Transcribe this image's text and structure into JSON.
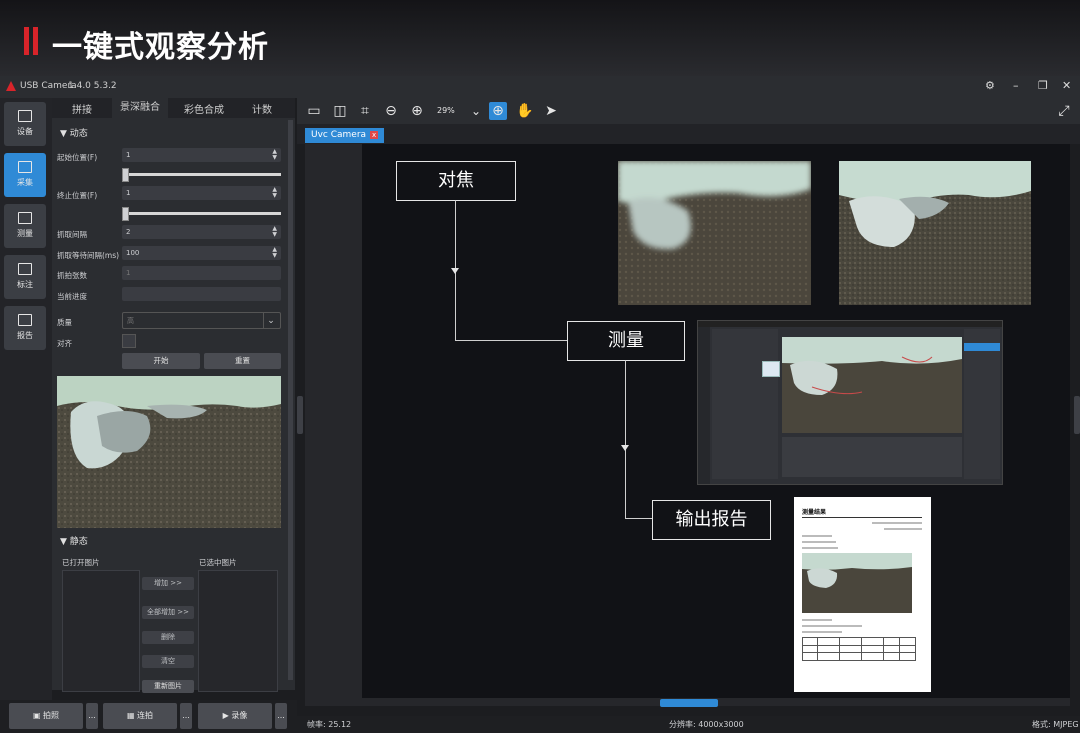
{
  "banner": {
    "title": "一键式观察分析"
  },
  "window": {
    "app_name": "USB Camera",
    "version": "1.4.0 5.3.2"
  },
  "nav": {
    "items": [
      {
        "label": "设备"
      },
      {
        "label": "采集"
      },
      {
        "label": "测量"
      },
      {
        "label": "标注"
      },
      {
        "label": "报告"
      }
    ],
    "active_index": 1
  },
  "panel": {
    "tabs": [
      "拼接",
      "景深融合",
      "彩色合成",
      "计数"
    ],
    "active_tab": 1,
    "dynamic_section": "▼ 动态",
    "start_pos_label": "起始位置(F)",
    "start_pos_value": "1",
    "end_pos_label": "终止位置(F)",
    "end_pos_value": "1",
    "capture_interval_label": "抓取间隔",
    "capture_interval_value": "2",
    "wait_interval_label": "抓取等待间隔(ms)",
    "wait_interval_value": "100",
    "shot_count_label": "抓拍张数",
    "shot_count_value": "1",
    "progress_label": "当前进度",
    "progress_value": "",
    "quality_label": "质量",
    "quality_value": "高",
    "align_label": "对齐",
    "start_button": "开始",
    "reset_button": "重置",
    "static_section": "▼ 静态",
    "opened_images_label": "已打开图片",
    "selected_images_label": "已选中图片",
    "add_button": "增加 >>",
    "add_all_button": "全部增加 >>",
    "delete_button": "删除",
    "clear_button": "清空",
    "rearrange_button": "重新图片"
  },
  "bottom": {
    "snap": "拍照",
    "burst": "连拍",
    "record": "录像",
    "more": "..."
  },
  "toolbar": {
    "zoom": "29%"
  },
  "doc_tab": {
    "label": "Uvc Camera",
    "close": "x"
  },
  "diagram": {
    "focus_label": "对焦",
    "measure_label": "测量",
    "report_label": "输出报告"
  },
  "report": {
    "title": "测量结果"
  },
  "status": {
    "fps": "帧率: 25.12",
    "resolution": "分辨率: 4000x3000",
    "format": "格式: MJPEG"
  },
  "colors": {
    "accent": "#2f8ad6",
    "banner_red": "#d8242a"
  }
}
